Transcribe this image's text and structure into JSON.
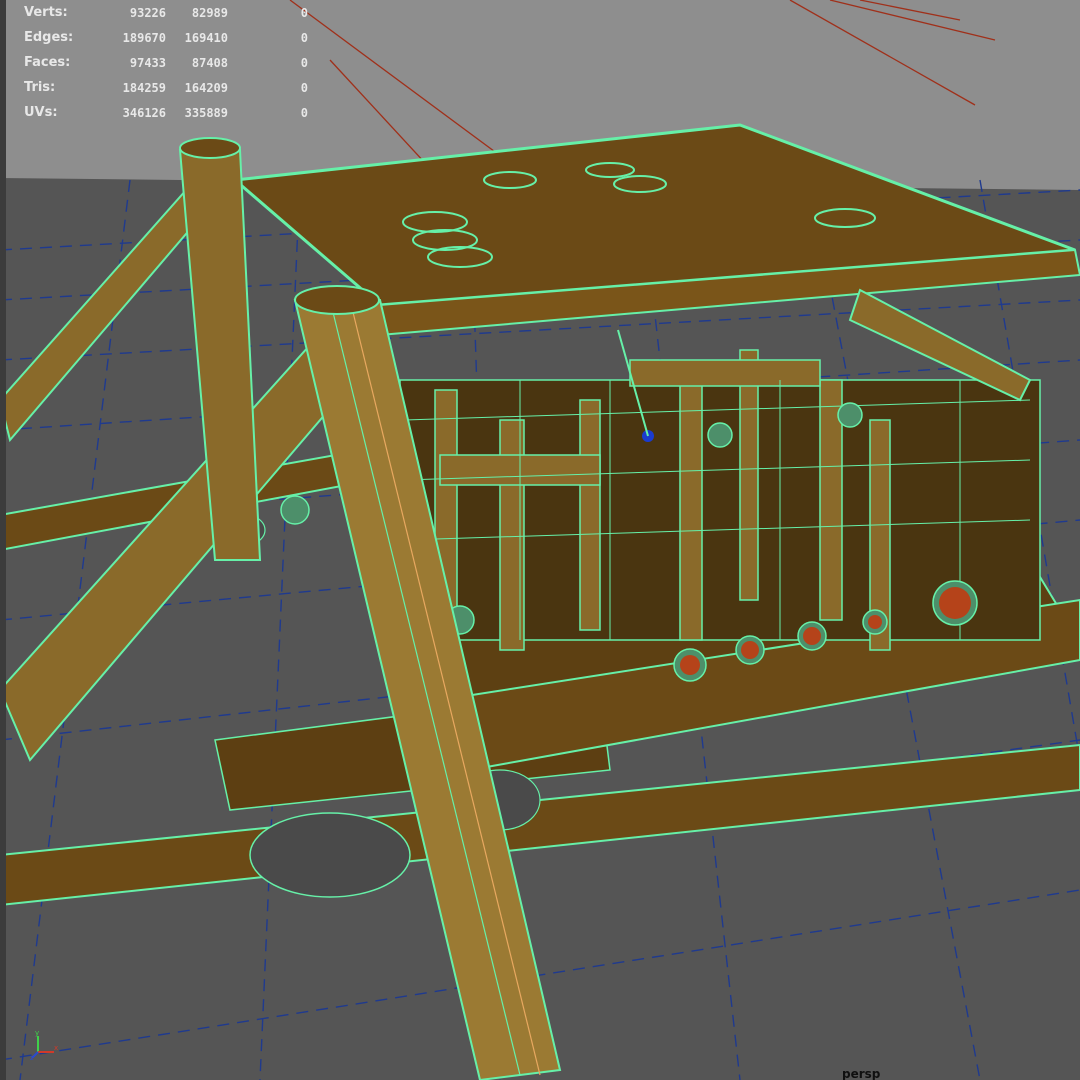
{
  "hud": {
    "rows": [
      {
        "label": "Verts:",
        "v1": "93226",
        "v2": "82989",
        "v3": "0"
      },
      {
        "label": "Edges:",
        "v1": "189670",
        "v2": "169410",
        "v3": "0"
      },
      {
        "label": "Faces:",
        "v1": "97433",
        "v2": "87408",
        "v3": "0"
      },
      {
        "label": "Tris:",
        "v1": "184259",
        "v2": "164209",
        "v3": "0"
      },
      {
        "label": "UVs:",
        "v1": "346126",
        "v2": "335889",
        "v3": "0"
      }
    ]
  },
  "viewport": {
    "camera": "persp",
    "axis_labels": {
      "y": "y",
      "x": "x",
      "z": "z"
    }
  },
  "colors": {
    "background_top": "#8e8e8e",
    "ground": "#555555",
    "grid": "#1f3a8f",
    "wire": "#66f0a8",
    "mesh": "#6b4a16",
    "mesh_dark": "#4f3510",
    "accent_red": "#b5431a"
  }
}
